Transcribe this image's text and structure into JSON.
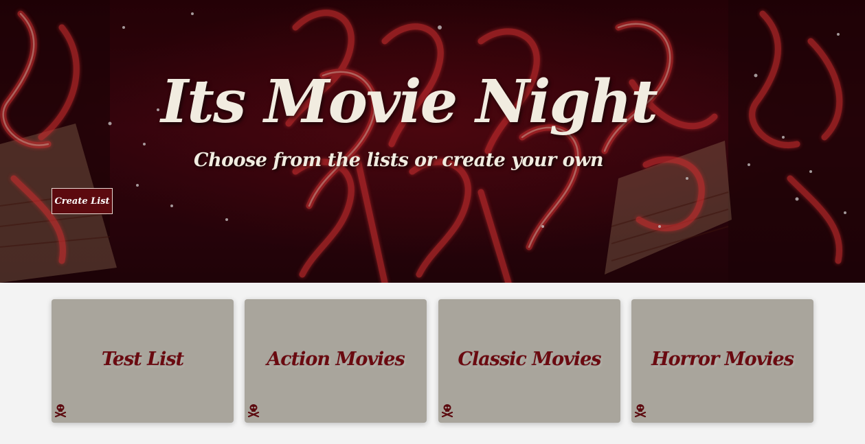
{
  "hero": {
    "title": "Its Movie Night",
    "subtitle": "Choose from the lists or create your own",
    "create_button": "Create List"
  },
  "lists": [
    {
      "title": "Test List",
      "delete_icon": "skull-crossbones-icon"
    },
    {
      "title": "Action Movies",
      "delete_icon": "skull-crossbones-icon"
    },
    {
      "title": "Classic Movies",
      "delete_icon": "skull-crossbones-icon"
    },
    {
      "title": "Horror Movies",
      "delete_icon": "skull-crossbones-icon"
    }
  ],
  "colors": {
    "accent": "#5c0a0f",
    "card_background": "#a9a59c",
    "card_title": "#6a0a10",
    "hero_text": "#f1ece0",
    "page_background": "#f3f3f3"
  }
}
